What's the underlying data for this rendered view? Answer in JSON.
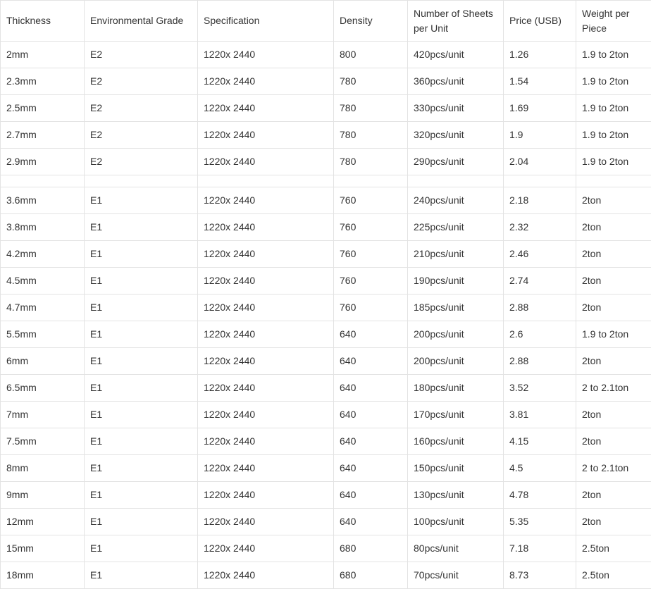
{
  "table": {
    "headers": [
      "Thickness",
      "Environmental Grade",
      "Specification",
      "Density",
      "Number of Sheets per Unit",
      "Price (USB)",
      "Weight per Piece"
    ],
    "rows_group1": [
      [
        "2mm",
        "E2",
        "1220x 2440",
        "800",
        "420pcs/unit",
        "1.26",
        "1.9 to 2ton"
      ],
      [
        "2.3mm",
        "E2",
        "1220x 2440",
        "780",
        "360pcs/unit",
        "1.54",
        "1.9 to 2ton"
      ],
      [
        "2.5mm",
        "E2",
        "1220x 2440",
        "780",
        "330pcs/unit",
        "1.69",
        "1.9 to 2ton"
      ],
      [
        "2.7mm",
        "E2",
        "1220x 2440",
        "780",
        "320pcs/unit",
        "1.9",
        "1.9 to 2ton"
      ],
      [
        "2.9mm",
        "E2",
        "1220x 2440",
        "780",
        "290pcs/unit",
        "2.04",
        "1.9 to 2ton"
      ]
    ],
    "rows_group2": [
      [
        "3.6mm",
        "E1",
        "1220x 2440",
        "760",
        "240pcs/unit",
        "2.18",
        "2ton"
      ],
      [
        "3.8mm",
        "E1",
        "1220x 2440",
        "760",
        "225pcs/unit",
        "2.32",
        "2ton"
      ],
      [
        "4.2mm",
        "E1",
        "1220x 2440",
        "760",
        "210pcs/unit",
        "2.46",
        "2ton"
      ],
      [
        "4.5mm",
        "E1",
        "1220x 2440",
        "760",
        "190pcs/unit",
        "2.74",
        "2ton"
      ],
      [
        "4.7mm",
        "E1",
        "1220x 2440",
        "760",
        "185pcs/unit",
        "2.88",
        "2ton"
      ],
      [
        "5.5mm",
        "E1",
        "1220x 2440",
        "640",
        "200pcs/unit",
        "2.6",
        "1.9 to 2ton"
      ],
      [
        "6mm",
        "E1",
        "1220x 2440",
        "640",
        "200pcs/unit",
        "2.88",
        "2ton"
      ],
      [
        "6.5mm",
        "E1",
        "1220x 2440",
        "640",
        "180pcs/unit",
        "3.52",
        "2 to 2.1ton"
      ],
      [
        "7mm",
        "E1",
        "1220x 2440",
        "640",
        "170pcs/unit",
        "3.81",
        "2ton"
      ],
      [
        "7.5mm",
        "E1",
        "1220x 2440",
        "640",
        "160pcs/unit",
        "4.15",
        "2ton"
      ],
      [
        "8mm",
        "E1",
        "1220x 2440",
        "640",
        "150pcs/unit",
        "4.5",
        "2 to 2.1ton"
      ],
      [
        "9mm",
        "E1",
        "1220x 2440",
        "640",
        "130pcs/unit",
        "4.78",
        "2ton"
      ],
      [
        "12mm",
        "E1",
        "1220x 2440",
        "640",
        "100pcs/unit",
        "5.35",
        "2ton"
      ],
      [
        "15mm",
        "E1",
        "1220x 2440",
        "680",
        "80pcs/unit",
        "7.18",
        "2.5ton"
      ],
      [
        "18mm",
        "E1",
        "1220x 2440",
        "680",
        "70pcs/unit",
        "8.73",
        "2.5ton"
      ]
    ]
  }
}
